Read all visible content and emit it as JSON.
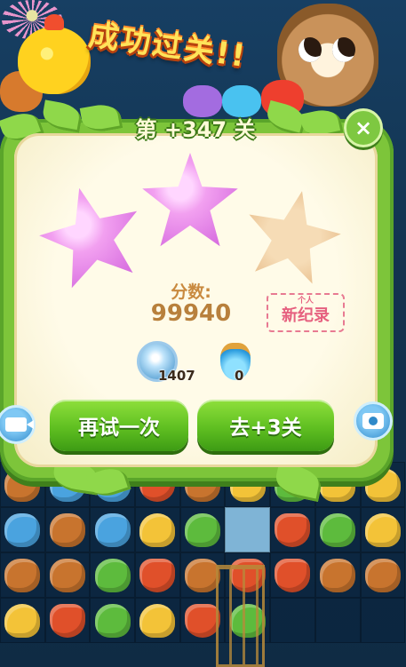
{
  "banner": {
    "title": "成功过关!!"
  },
  "dialog": {
    "level_label": "第 +347 关",
    "close_glyph": "×",
    "stars": [
      {
        "state": "filled"
      },
      {
        "state": "filled"
      },
      {
        "state": "empty"
      }
    ],
    "score_label": "分数:",
    "score_value": "99940",
    "record_small": "个人",
    "record_big": "新纪录",
    "items": {
      "coin_count": "1407",
      "potion_count": "0"
    },
    "buttons": {
      "retry_label": "再试一次",
      "next_label": "去+3关"
    }
  },
  "side_buttons": {
    "left_icon": "video-camera-icon",
    "right_icon": "camera-icon"
  },
  "colors": {
    "star_filled": "#e88ae8",
    "star_empty": "#e9c08f",
    "button_green": "#5fbf21",
    "score_text": "#b8803c",
    "record_pink": "#e6607f"
  },
  "board": {
    "rows": [
      [
        "bear",
        "hippo",
        "hippo",
        "fox",
        "bear",
        "chick",
        "frog",
        "chick",
        "chick"
      ],
      [
        "hippo",
        "bear",
        "hippo",
        "chick",
        "frog",
        "empty",
        "fox",
        "frog",
        "chick"
      ],
      [
        "bear",
        "bear",
        "frog",
        "fox",
        "bear",
        "fox",
        "fox",
        "bear",
        "bear"
      ],
      [
        "chick",
        "fox",
        "frog",
        "chick",
        "fox",
        "frog",
        "empty",
        "empty",
        "empty"
      ]
    ]
  }
}
